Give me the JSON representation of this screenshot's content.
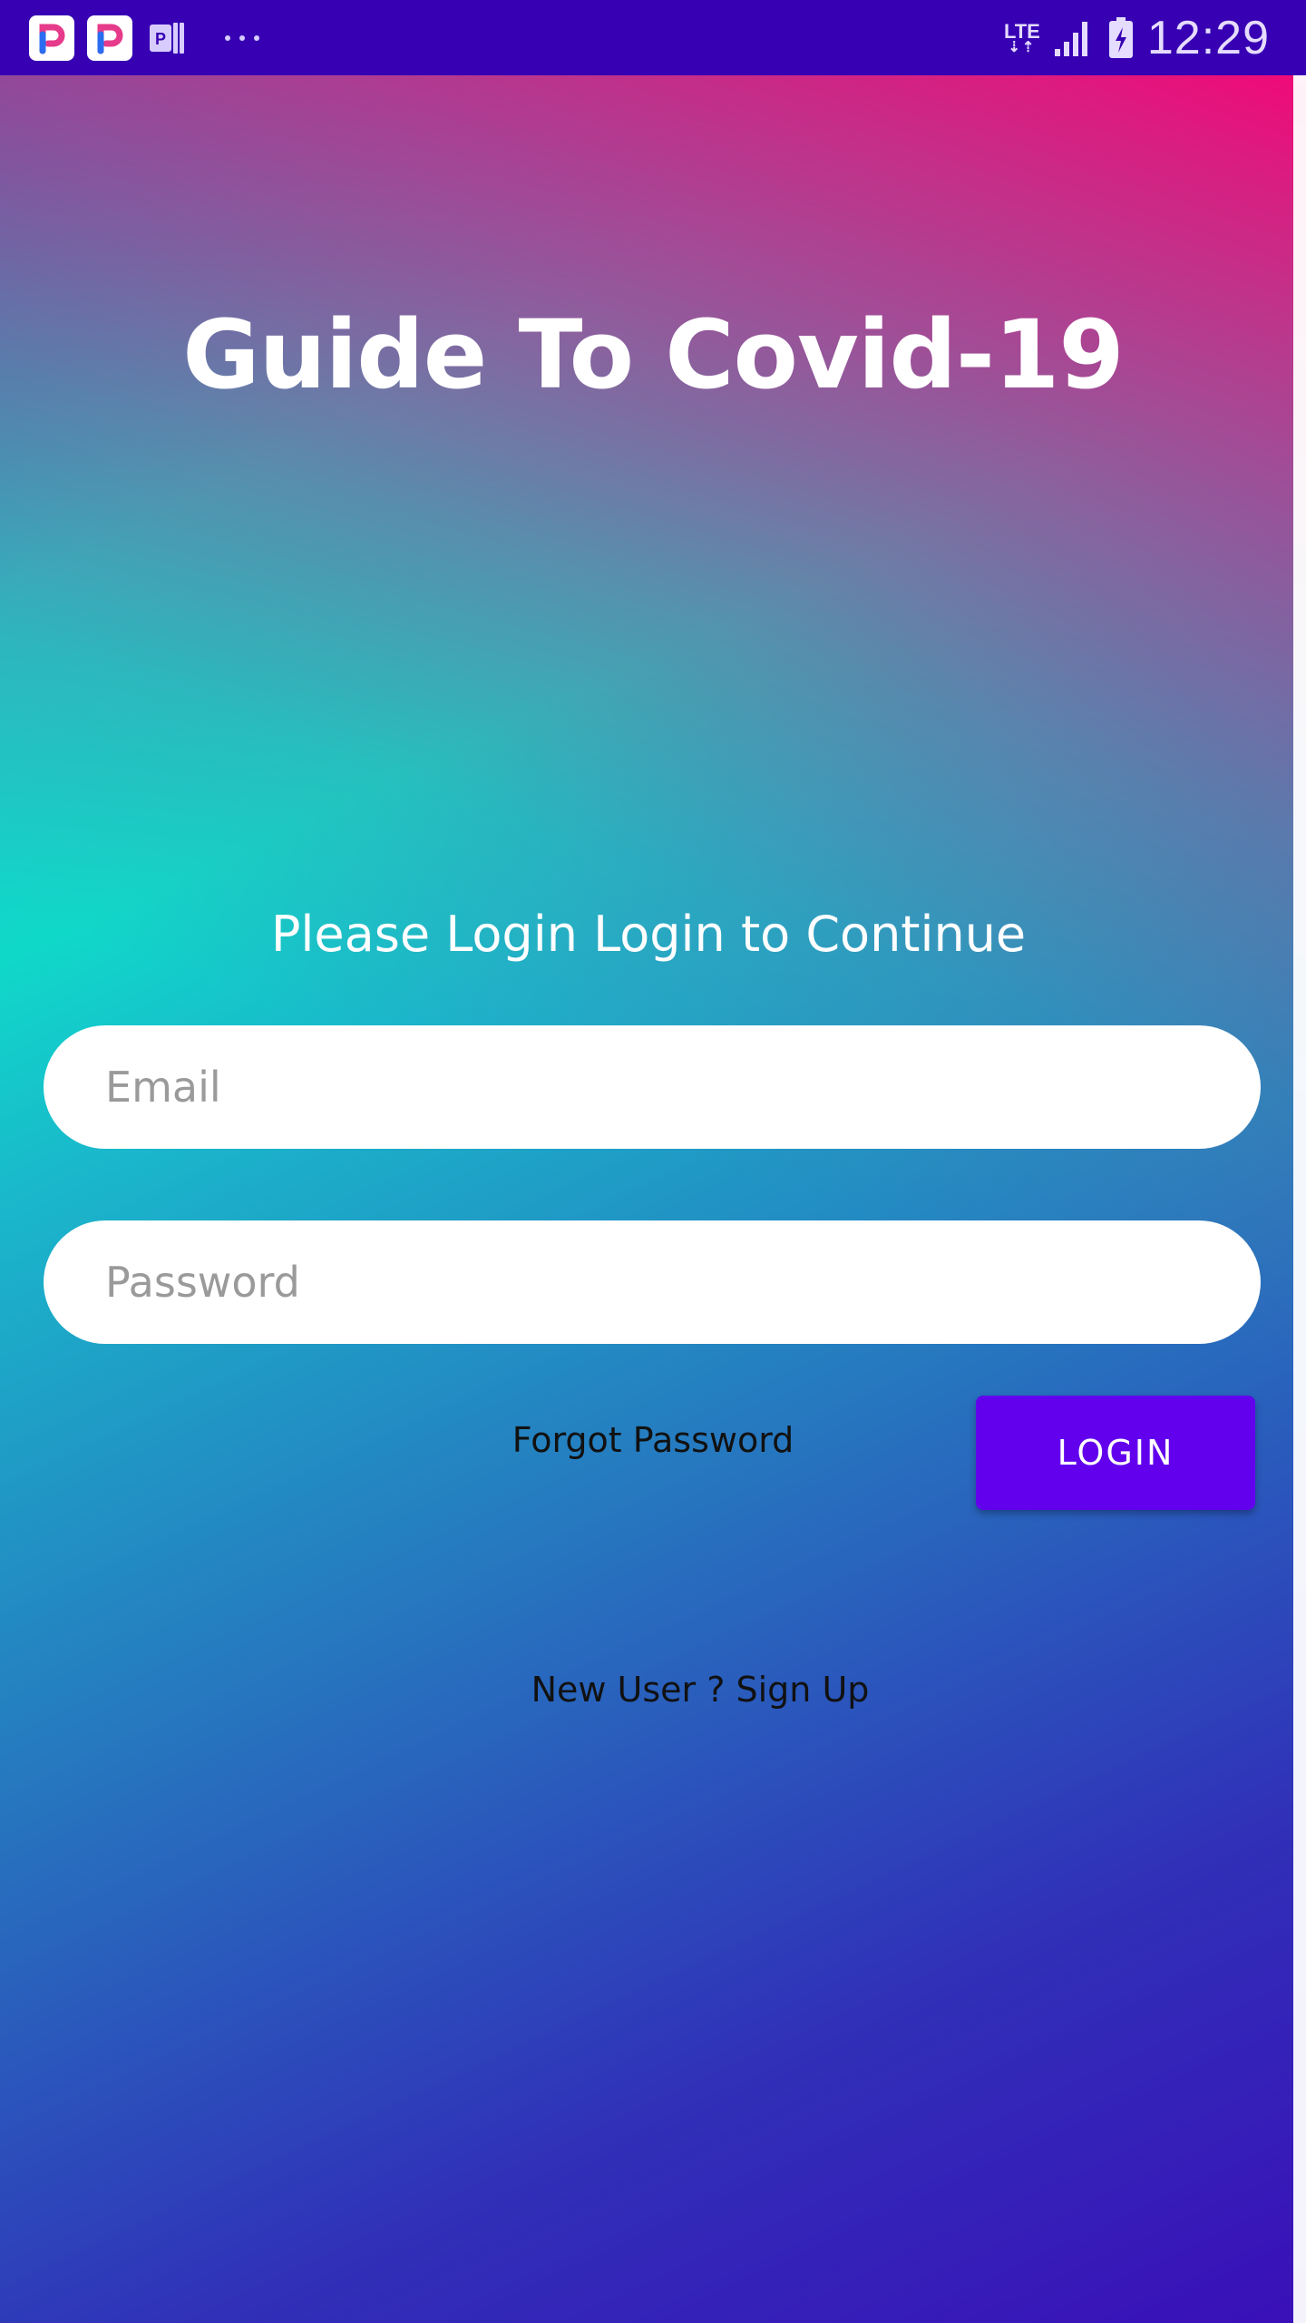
{
  "status_bar": {
    "time": "12:29",
    "network": "LTE",
    "icons": [
      "pinterest-like-app-icon",
      "pinterest-like-app-icon",
      "word-app-icon",
      "more-notifications-icon",
      "signal-icon",
      "battery-charging-icon"
    ]
  },
  "login": {
    "title": "Guide To Covid-19",
    "subtitle": "Please Login Login to Continue",
    "email_placeholder": "Email",
    "password_placeholder": "Password",
    "forgot_label": "Forgot Password",
    "login_label": "LOGIN",
    "signup_label": "New User ? Sign Up"
  },
  "colors": {
    "status_bar": "#3700b3",
    "button": "#6200ee",
    "gradient_pink": "#f00a78",
    "gradient_teal": "#10d8c9",
    "gradient_blue": "#3030b8"
  }
}
